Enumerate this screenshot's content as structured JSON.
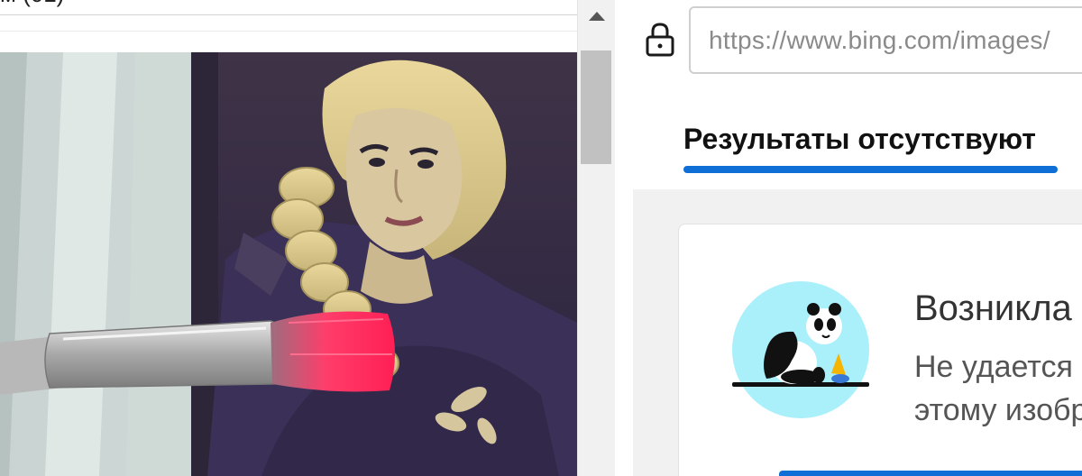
{
  "left": {
    "title": "м (01)",
    "image_alt": "Фото девушки с косой и кистью"
  },
  "address_bar": {
    "url": "https://www.bing.com/images/"
  },
  "tabs": {
    "active_label": "Результаты отсутствуют"
  },
  "error_card": {
    "title": "Возникла",
    "line1": "Не удается",
    "line2": "этому изобр"
  },
  "colors": {
    "accent": "#0f6fd6",
    "panda_bg": "#aaf0fb"
  },
  "icons": {
    "lock": "lock-icon",
    "scroll_up": "scroll-up-arrow-icon",
    "panda": "panda-illustration"
  }
}
